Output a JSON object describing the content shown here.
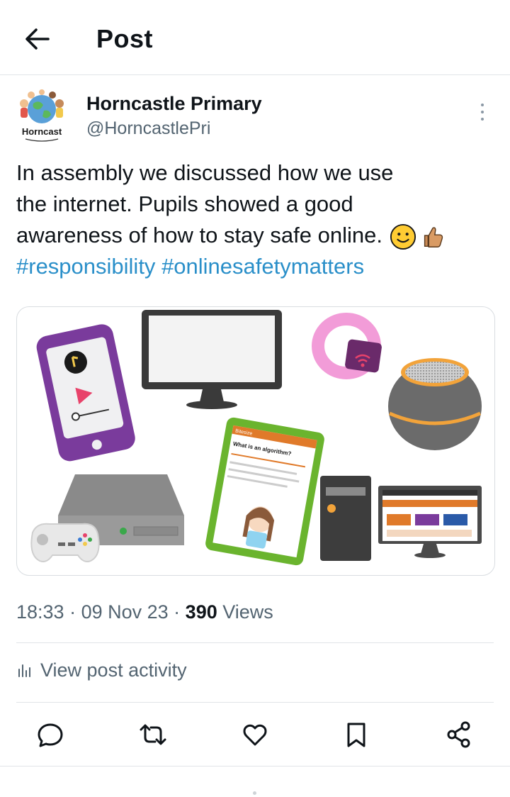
{
  "header": {
    "title": "Post",
    "back_icon": "arrow-left-icon"
  },
  "author": {
    "name": "Horncastle Primary",
    "handle": "@HorncastlePri",
    "avatar_text": "Horncast"
  },
  "post": {
    "line1": "In assembly we discussed how we use",
    "line2": "the internet. Pupils showed a good",
    "line3": "awareness of how to stay safe online.",
    "hashtag1": "#responsibility",
    "hashtag2": "#onlinesafetymatters",
    "emojis": [
      "slightly-smiling-face-icon",
      "thumbs-up-icon"
    ],
    "hashtag_color": "#2a8fc9"
  },
  "media": {
    "tablet": {
      "brand": "Bitesize",
      "heading": "What is an algorithm?"
    }
  },
  "meta": {
    "time": "18:33",
    "separator": " · ",
    "date": "09 Nov 23",
    "views_count": "390",
    "views_label": " Views"
  },
  "activity": {
    "label": "View post activity",
    "icon": "bar-chart-icon"
  },
  "actions": [
    "reply-icon",
    "repost-icon",
    "like-icon",
    "bookmark-icon",
    "share-icon"
  ]
}
